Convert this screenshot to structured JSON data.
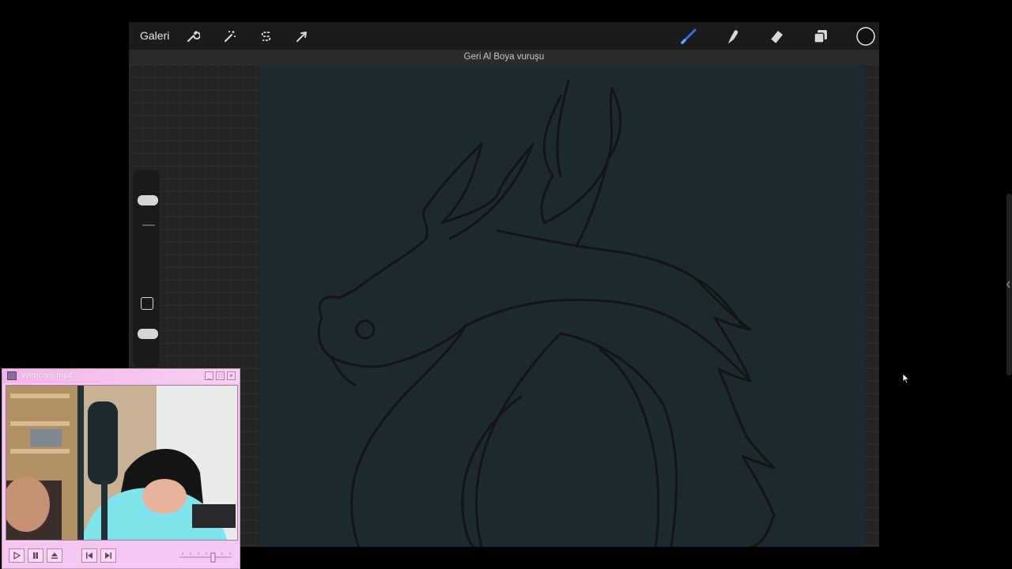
{
  "toolbar": {
    "gallery_label": "Galeri",
    "left_tools": [
      "wrench-icon",
      "magic-wand-icon",
      "selection-s-icon",
      "transform-arrow-icon"
    ],
    "right_tools": [
      "brush-icon",
      "smudge-icon",
      "eraser-icon",
      "layers-icon",
      "color-circle-icon"
    ],
    "accent_color": "#2f6fe0"
  },
  "banner": {
    "text": "Geri Al Boya vuruşu"
  },
  "player": {
    "title": "Webcam.mp4",
    "buttons": {
      "minimize": "_",
      "maximize": "□",
      "close": "×"
    },
    "controls": [
      "play-icon",
      "pause-icon",
      "eject-icon",
      "previous-icon",
      "next-icon"
    ],
    "theme_color": "#f6c8f1"
  }
}
